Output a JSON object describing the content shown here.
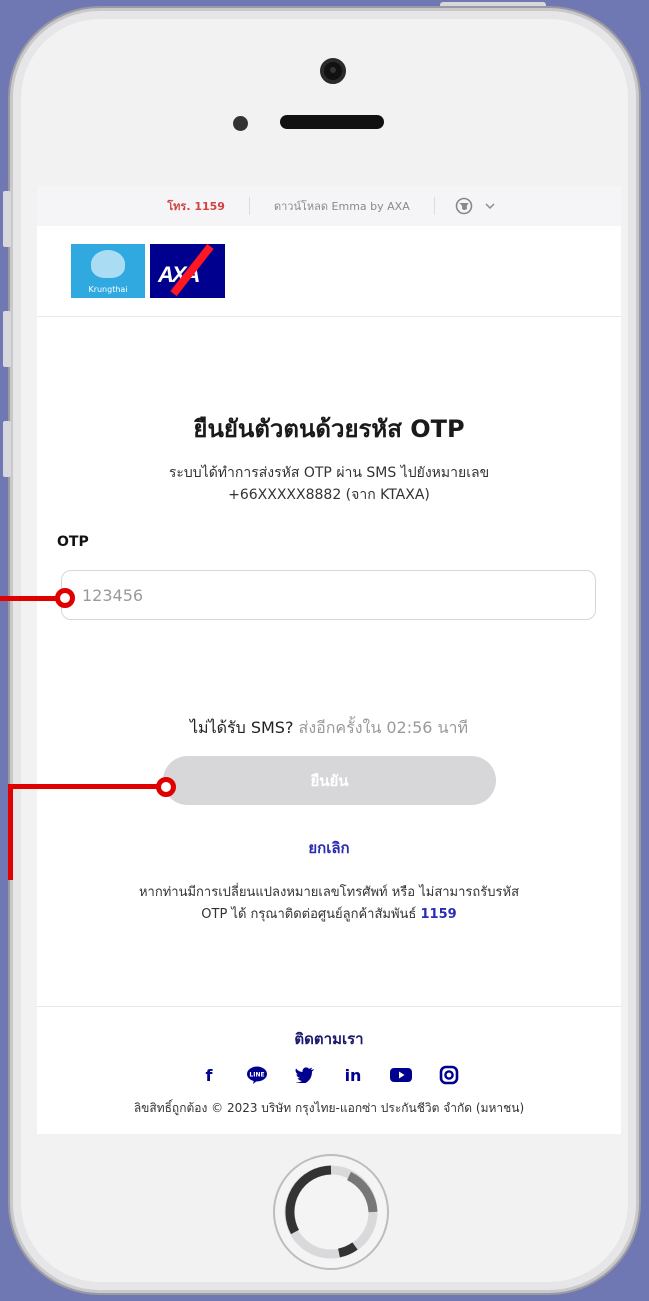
{
  "topbar": {
    "call_label": "โทร. 1159",
    "download_label": "ดาวน์โหลด Emma by AXA",
    "language_icon": "globe-icon",
    "dropdown_icon": "chevron-down-icon"
  },
  "brand": {
    "krungthai_label": "Krungthai",
    "axa_label": "AXA",
    "krungthai_color": "#2fa9e0",
    "axa_color": "#00008f"
  },
  "main": {
    "title": "ยืนยันตัวตนด้วยรหัส OTP",
    "desc_line1": "ระบบได้ทำการส่งรหัส OTP ผ่าน SMS ไปยังหมายเลข",
    "desc_line2": "+66XXXXX8882 (จาก KTAXA)",
    "otp_label": "OTP",
    "otp_placeholder": "123456",
    "resend_prefix": "ไม่ได้รับ SMS?",
    "resend_countdown": "ส่งอีกครั้งใน 02:56 นาที",
    "confirm_label": "ยืนยัน",
    "cancel_label": "ยกเลิก",
    "help_line1": "หากท่านมีการเปลี่ยนแปลงหมายเลขโทรศัพท์ หรือ ไม่สามารถรับรหัส",
    "help_line2": "OTP ได้ กรุณาติดต่อศูนย์ลูกค้าสัมพันธ์",
    "help_number": "1159"
  },
  "footer": {
    "follow_label": "ติดตามเรา",
    "social": [
      {
        "icon": "facebook-icon",
        "glyph": "f"
      },
      {
        "icon": "line-icon",
        "glyph": "💬"
      },
      {
        "icon": "twitter-icon",
        "glyph": "🐦"
      },
      {
        "icon": "linkedin-icon",
        "glyph": "in"
      },
      {
        "icon": "youtube-icon",
        "glyph": "▶"
      },
      {
        "icon": "instagram-icon",
        "glyph": "◎"
      }
    ],
    "copyright": "ลิขสิทธิ์ถูกต้อง © 2023 บริษัท กรุงไทย-แอกซ่า ประกันชีวิต จำกัด (มหาชน)"
  },
  "colors": {
    "background": "#6f78b3",
    "annotation": "#e00000",
    "link": "#2d2db4"
  }
}
